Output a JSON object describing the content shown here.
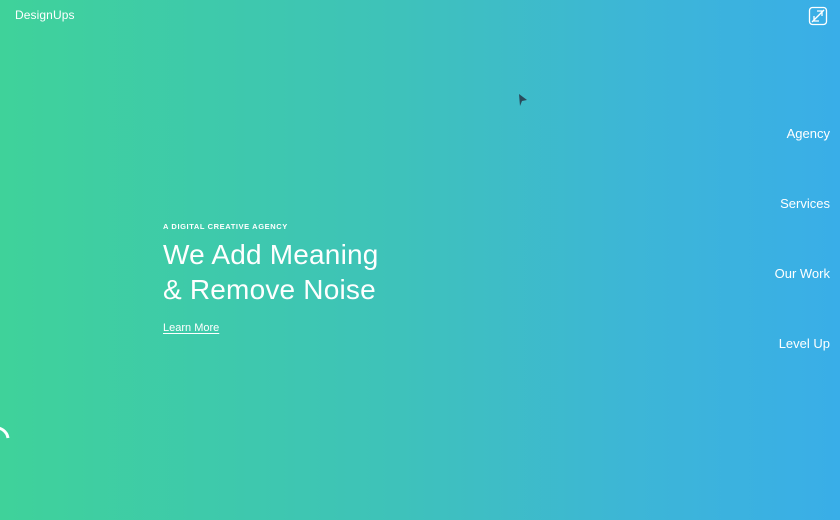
{
  "brand": {
    "name": "DesignUps",
    "logo_icon": "designups-logo-icon"
  },
  "nav": {
    "items": [
      {
        "label": "Agency"
      },
      {
        "label": "Services"
      },
      {
        "label": "Our Work"
      },
      {
        "label": "Level Up"
      }
    ]
  },
  "hero": {
    "eyebrow": "A DIGITAL CREATIVE AGENCY",
    "headline_line1": "We Add Meaning",
    "headline_line2": "& Remove Noise",
    "cta_label": "Learn More"
  },
  "colors": {
    "gradient_start": "#3fd29a",
    "gradient_end": "#39aee8",
    "text": "#ffffff",
    "cursor": "#2a4a5a"
  }
}
